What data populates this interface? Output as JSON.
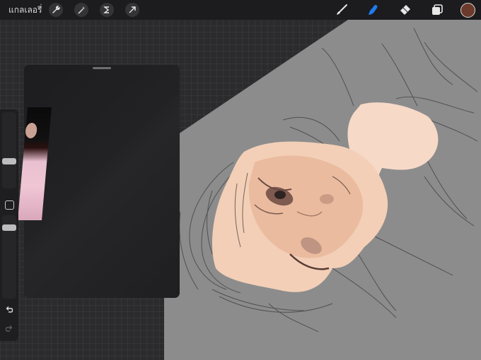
{
  "topbar": {
    "gallery_label": "แกลเลอรี่",
    "left_tools": [
      "wrench-icon",
      "magic-wand-icon",
      "selection-icon",
      "transform-arrow-icon"
    ],
    "right_tools": [
      "brush-icon",
      "smudge-icon",
      "eraser-icon",
      "layers-icon"
    ],
    "active_tool": "smudge-icon",
    "active_color": "#6b3a2a",
    "accent_color": "#1e7bf0"
  },
  "sidebar": {
    "brush_size_level": 0.35,
    "opacity_level": 0.6
  },
  "reference_panel": {
    "state": "open"
  }
}
